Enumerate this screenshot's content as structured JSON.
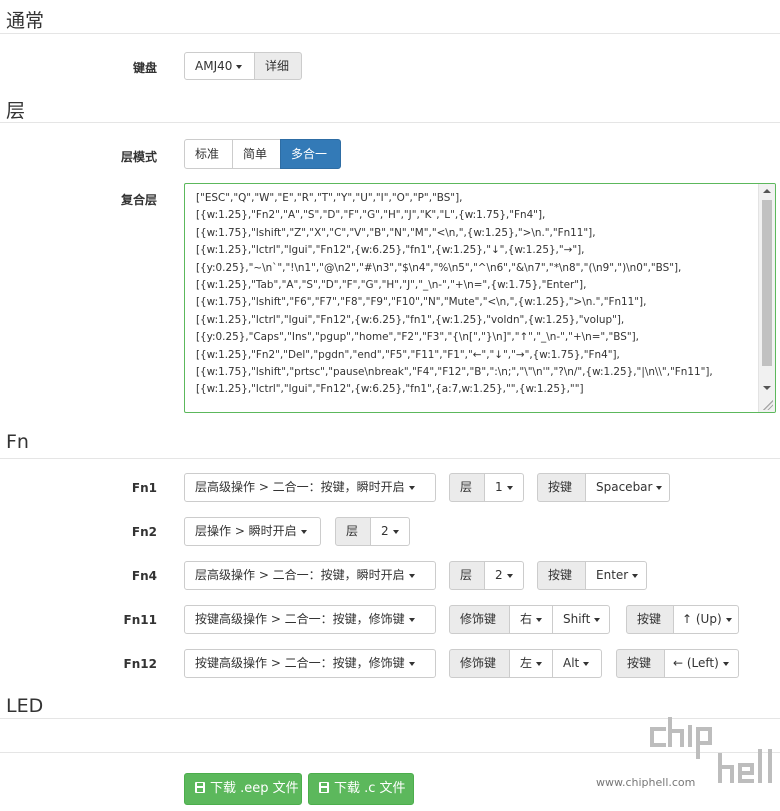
{
  "sections": {
    "general": "通常",
    "layers": "层",
    "fn": "Fn",
    "led": "LED"
  },
  "keyboard": {
    "label": "键盘",
    "model": "AMJ40",
    "detail_button": "详细"
  },
  "layer_mode": {
    "label": "层模式",
    "options": [
      "标准",
      "简单",
      "多合一"
    ],
    "selected": "多合一"
  },
  "composite_layer": {
    "label": "复合层",
    "lines": [
      "[\"ESC\",\"Q\",\"W\",\"E\",\"R\",\"T\",\"Y\",\"U\",\"I\",\"O\",\"P\",\"BS\"],",
      "[{w:1.25},\"Fn2\",\"A\",\"S\",\"D\",\"F\",\"G\",\"H\",\"J\",\"K\",\"L\",{w:1.75},\"Fn4\"],",
      "[{w:1.75},\"lshift\",\"Z\",\"X\",\"C\",\"V\",\"B\",\"N\",\"M\",\"<\\n,\",{w:1.25},\">\\n.\",\"Fn11\"],",
      "[{w:1.25},\"lctrl\",\"lgui\",\"Fn12\",{w:6.25},\"fn1\",{w:1.25},\"↓\",{w:1.25},\"→\"],",
      "[{y:0.25},\"~\\n`\",\"!\\n1\",\"@\\n2\",\"#\\n3\",\"$\\n4\",\"%\\n5\",\"^\\n6\",\"&\\n7\",\"*\\n8\",\"(\\n9\",\")\\n0\",\"BS\"],",
      "[{w:1.25},\"Tab\",\"A\",\"S\",\"D\",\"F\",\"G\",\"H\",\"J\",\"_\\n-\",\"+\\n=\",{w:1.75},\"Enter\"],",
      "[{w:1.75},\"lshift\",\"F6\",\"F7\",\"F8\",\"F9\",\"F10\",\"N\",\"Mute\",\"<\\n,\",{w:1.25},\">\\n.\",\"Fn11\"],",
      "[{w:1.25},\"lctrl\",\"lgui\",\"Fn12\",{w:6.25},\"fn1\",{w:1.25},\"voldn\",{w:1.25},\"volup\"],",
      "[{y:0.25},\"Caps\",\"Ins\",\"pgup\",\"home\",\"F2\",\"F3\",\"{\\n[\",\"}\\n]\",\"↑\",\"_\\n-\",\"+\\n=\",\"BS\"],",
      "[{w:1.25},\"Fn2\",\"Del\",\"pgdn\",\"end\",\"F5\",\"F11\",\"F1\",\"←\",\"↓\",\"→\",{w:1.75},\"Fn4\"],",
      "[{w:1.75},\"lshift\",\"prtsc\",\"pause\\nbreak\",\"F4\",\"F12\",\"B\",\":\\n;\",\"\\\"\\n'\",\"?\\n/\",{w:1.25},\"|\\n\\\\\",\"Fn11\"],",
      "[{w:1.25},\"lctrl\",\"lgui\",\"Fn12\",{w:6.25},\"fn1\",{a:7,w:1.25},\"\",{w:1.25},\"\"]"
    ]
  },
  "fn_rows": [
    {
      "label": "Fn1",
      "action": "层高级操作 > 二合一：按键，瞬时开启",
      "layer_addon": "层",
      "layer_value": "1",
      "key_addon": "按键",
      "key_value": "Spacebar"
    },
    {
      "label": "Fn2",
      "action": "层操作 > 瞬时开启",
      "layer_addon": "层",
      "layer_value": "2"
    },
    {
      "label": "Fn4",
      "action": "层高级操作 > 二合一：按键，瞬时开启",
      "layer_addon": "层",
      "layer_value": "2",
      "key_addon": "按键",
      "key_value": "Enter"
    },
    {
      "label": "Fn11",
      "action": "按键高级操作 > 二合一：按键，修饰键",
      "mod_addon": "修饰键",
      "mod_side": "右",
      "mod_key": "Shift",
      "key_addon": "按键",
      "key_value": "↑ (Up)"
    },
    {
      "label": "Fn12",
      "action": "按键高级操作 > 二合一：按键，修饰键",
      "mod_addon": "修饰键",
      "mod_side": "左",
      "mod_key": "Alt",
      "key_addon": "按键",
      "key_value": "← (Left)"
    }
  ],
  "downloads": {
    "eep": "下载 .eep 文件",
    "c": "下载 .c 文件"
  },
  "watermark": {
    "url": "www.chiphell.com",
    "logo_text": "chiphell"
  },
  "colors": {
    "primary": "#337ab7",
    "success": "#5cb85c",
    "addon_bg": "#ebebeb"
  }
}
